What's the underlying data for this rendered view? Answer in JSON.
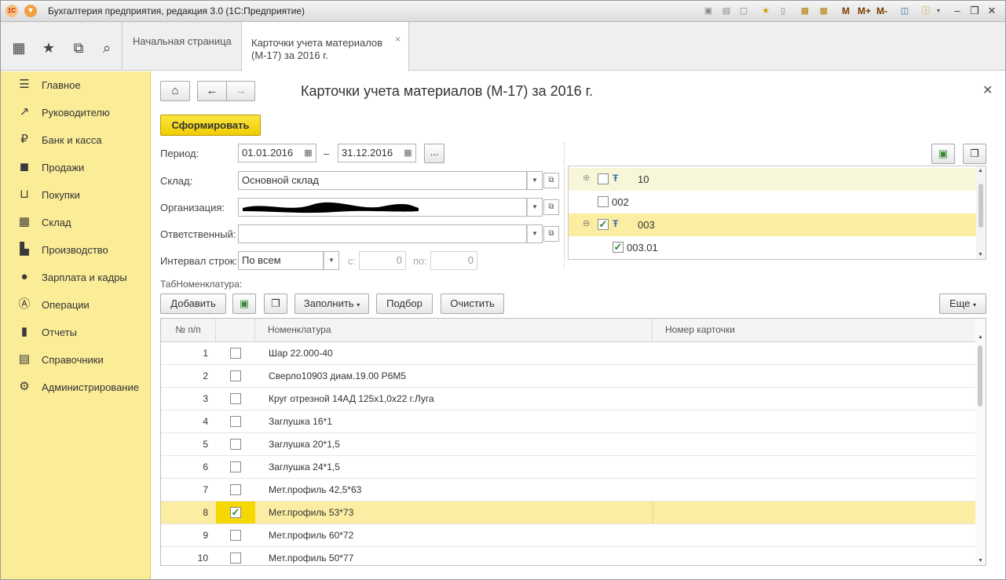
{
  "window": {
    "title": "Бухгалтерия предприятия, редакция 3.0  (1С:Предприятие)",
    "toolbar_mem": [
      "M",
      "M+",
      "M-"
    ]
  },
  "tabs": [
    {
      "label": "Начальная страница"
    },
    {
      "label": "Карточки учета материалов (М-17) за 2016 г.",
      "active": true
    }
  ],
  "sidebar": {
    "items": [
      {
        "label": "Главное",
        "icon": "menu-icon"
      },
      {
        "label": "Руководителю",
        "icon": "trend-icon"
      },
      {
        "label": "Банк и касса",
        "icon": "ruble-icon"
      },
      {
        "label": "Продажи",
        "icon": "bag-icon"
      },
      {
        "label": "Покупки",
        "icon": "cart-icon"
      },
      {
        "label": "Склад",
        "icon": "warehouse-icon"
      },
      {
        "label": "Производство",
        "icon": "factory-icon"
      },
      {
        "label": "Зарплата и кадры",
        "icon": "person-icon"
      },
      {
        "label": "Операции",
        "icon": "operations-icon"
      },
      {
        "label": "Отчеты",
        "icon": "chart-icon"
      },
      {
        "label": "Справочники",
        "icon": "book-icon"
      },
      {
        "label": "Администрирование",
        "icon": "gear-icon"
      }
    ]
  },
  "form": {
    "title": "Карточки учета материалов (М-17) за 2016 г.",
    "generate_label": "Сформировать",
    "period_label": "Период:",
    "period_from": "01.01.2016",
    "period_dash": "–",
    "period_to": "31.12.2016",
    "ellipsis": "...",
    "warehouse_label": "Склад:",
    "warehouse_value": "Основной склад",
    "org_label": "Организация:",
    "org_value": "",
    "responsible_label": "Ответственный:",
    "responsible_value": "",
    "interval_label": "Интервал строк:",
    "interval_value": "По всем",
    "from_label": "с:",
    "from_value": "0",
    "to_label": "по:",
    "to_value": "0",
    "table_caption": "ТабНоменклатура:"
  },
  "tree": [
    {
      "label": "10",
      "checked": false,
      "group": true,
      "expander": "⊕"
    },
    {
      "label": "002",
      "checked": false,
      "group": false,
      "expander": ""
    },
    {
      "label": "003",
      "checked": true,
      "group": true,
      "expander": "⊖"
    },
    {
      "label": "003.01",
      "checked": true,
      "group": false,
      "expander": ""
    }
  ],
  "table_toolbar": {
    "add": "Добавить",
    "fill": "Заполнить",
    "pick": "Подбор",
    "clear": "Очистить",
    "more": "Еще"
  },
  "table": {
    "headers": [
      "№ п/п",
      "",
      "Номенклатура",
      "Номер карточки"
    ],
    "rows": [
      {
        "n": "1",
        "checked": false,
        "name": "Шар 22.000-40"
      },
      {
        "n": "2",
        "checked": false,
        "name": "Сверло10903  диам.19.00 Р6М5"
      },
      {
        "n": "3",
        "checked": false,
        "name": "Круг отрезной 14АД 125х1,0х22 г.Луга"
      },
      {
        "n": "4",
        "checked": false,
        "name": "Заглушка 16*1"
      },
      {
        "n": "5",
        "checked": false,
        "name": "Заглушка 20*1,5"
      },
      {
        "n": "6",
        "checked": false,
        "name": "Заглушка 24*1,5"
      },
      {
        "n": "7",
        "checked": false,
        "name": "Мет.профиль 42,5*63"
      },
      {
        "n": "8",
        "checked": true,
        "name": "Мет.профиль 53*73"
      },
      {
        "n": "9",
        "checked": false,
        "name": "Мет.профиль 60*72"
      },
      {
        "n": "10",
        "checked": false,
        "name": "Мет.профиль 50*77"
      }
    ]
  },
  "colors": {
    "sidebar_bg": "#fbec98",
    "highlight_row": "#fbeda2",
    "generate_btn": "#f5d800"
  }
}
